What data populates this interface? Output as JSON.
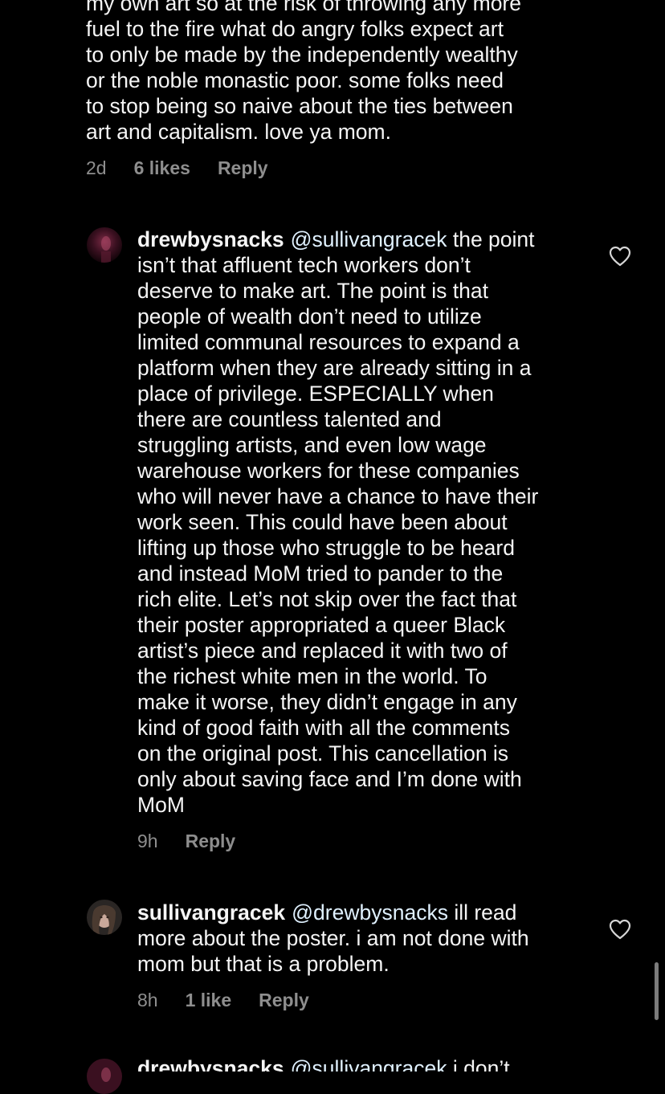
{
  "comment_top": {
    "text_lines": [
      "my own art so at the risk of throwing any more",
      "fuel to the fire what do angry folks expect art",
      "to only be made by the independently wealthy",
      "or the noble monastic  poor. some folks need",
      "to stop being so naive about the ties between",
      "art and capitalism. love ya mom."
    ],
    "time": "2d",
    "likes": "6 likes",
    "reply": "Reply"
  },
  "comment_drew": {
    "username": "drewbysnacks",
    "mention": "@sullivangracek",
    "first_line_rest": "the point",
    "text_lines": [
      "isn’t that affluent tech workers don’t",
      "deserve to make art. The point is that",
      "people of wealth don’t need to utilize",
      "limited communal resources to expand a",
      "platform when they are already sitting in a",
      "place of privilege. ESPECIALLY when",
      "there are countless talented and",
      "struggling artists, and even low wage",
      "warehouse workers for these companies",
      "who will never have a chance to have their",
      "work seen. This could have been about",
      "lifting up those who struggle to be heard",
      "and instead MoM tried to pander to the",
      "rich elite. Let’s not skip over the fact that",
      "their poster appropriated a queer Black",
      "artist’s piece and replaced it with two of",
      "the richest white men in the world. To",
      "make it worse, they didn’t engage in any",
      "kind of good faith with all the comments",
      "on the original post. This cancellation is",
      "only about saving face and I’m done with",
      "MoM"
    ],
    "time": "9h",
    "reply": "Reply",
    "avatar_icon": "avatar-drewbysnacks",
    "like_icon": "heart-outline-icon"
  },
  "comment_sullivan": {
    "username": "sullivangracek",
    "mention": "@drewbysnacks",
    "first_line_rest": "ill read",
    "text_lines": [
      "more about the poster. i am not done with",
      "mom but that is a problem."
    ],
    "time": "8h",
    "likes": "1 like",
    "reply": "Reply",
    "avatar_icon": "avatar-sullivangracek",
    "like_icon": "heart-outline-icon"
  },
  "comment_bottom_cut": {
    "username": "drewbysnacks",
    "mention": "@sullivangracek",
    "first_line_rest": "i don’t"
  },
  "colors": {
    "background": "#000000",
    "text": "#f5f5f5",
    "meta": "#8e8e8e",
    "mention": "#e0f1ff"
  }
}
